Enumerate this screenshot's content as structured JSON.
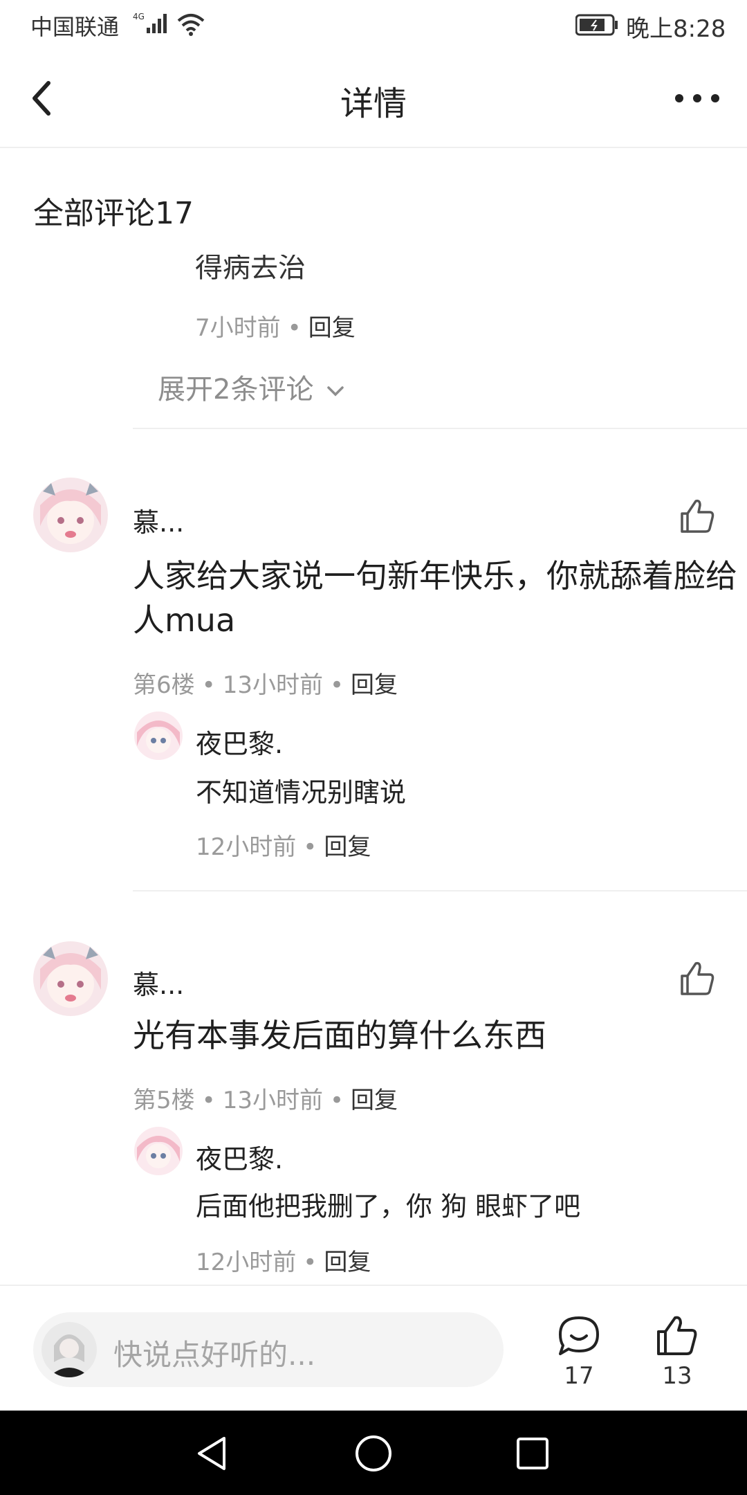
{
  "status_bar": {
    "carrier": "中国联通",
    "network": "4G",
    "time": "晚上8:28"
  },
  "header": {
    "title": "详情"
  },
  "comments": {
    "heading": "全部评论17",
    "clipped": {
      "text": "得病去治",
      "time": "7小时前",
      "reply_label": "回复",
      "expand_label": "展开2条评论"
    },
    "items": [
      {
        "username": "慕...",
        "text": "人家给大家说一句新年快乐，你就舔着脸给人mua",
        "floor": "第6楼",
        "time": "13小时前",
        "reply_label": "回复",
        "reply": {
          "username": "夜巴黎.",
          "text": "不知道情况别瞎说",
          "time": "12小时前",
          "reply_label": "回复"
        }
      },
      {
        "username": "慕...",
        "text": "光有本事发后面的算什么东西",
        "floor": "第5楼",
        "time": "13小时前",
        "reply_label": "回复",
        "reply": {
          "username": "夜巴黎.",
          "text": "后面他把我删了，你 狗 眼虾了吧",
          "time": "12小时前",
          "reply_label": "回复"
        }
      }
    ]
  },
  "bottom_bar": {
    "input_placeholder": "快说点好听的...",
    "comment_count": "17",
    "like_count": "13"
  },
  "colors": {
    "text_primary": "#1f1f1f",
    "text_muted": "#9a9a9a",
    "divider": "#efefef",
    "input_bg": "#f4f4f4",
    "nav_bar": "#000000"
  },
  "icons": [
    "signal-icon",
    "wifi-icon",
    "battery-icon",
    "back-icon",
    "more-icon",
    "chevron-down-icon",
    "thumbs-up-icon",
    "comment-icon",
    "nav-back-icon",
    "nav-home-icon",
    "nav-recents-icon"
  ]
}
